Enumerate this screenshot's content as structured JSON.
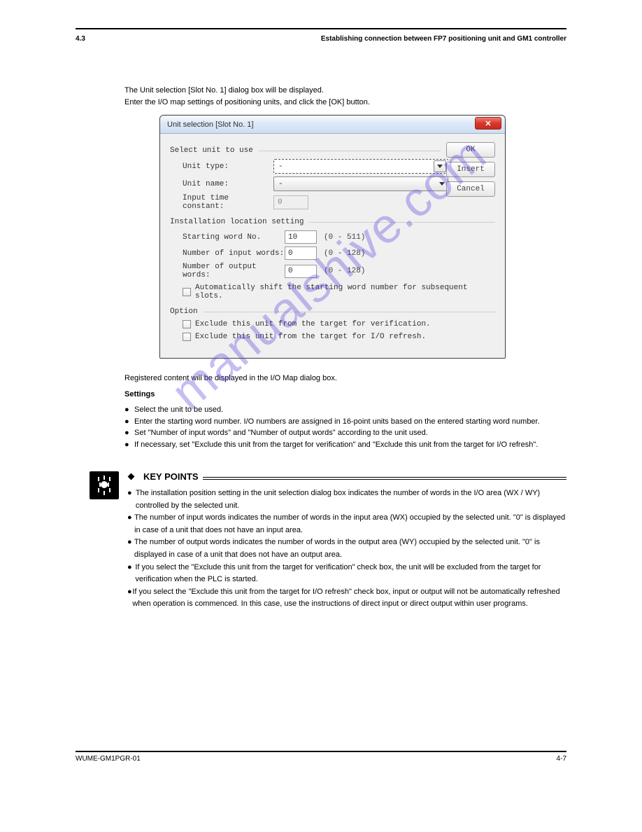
{
  "header": "Establishing connection between FP7 positioning unit and GM1 controller",
  "intro_line1": "The Unit selection [Slot No. 1] dialog box will be displayed.",
  "intro_line2": "Enter the I/O map settings of positioning units, and click the [OK] button.",
  "dialog": {
    "title": "Unit selection [Slot No. 1]",
    "section_select_unit": "Select unit to use",
    "unit_type_label": "Unit type:",
    "unit_type_value": "-",
    "unit_name_label": "Unit name:",
    "unit_name_value": "-",
    "input_time_label": "Input time constant:",
    "input_time_value": "0",
    "section_installation": "Installation location setting",
    "starting_word_label": "Starting word No.",
    "starting_word_value": "10",
    "starting_word_range": "(0 - 511)",
    "num_input_label": "Number of input words:",
    "num_input_value": "0",
    "num_input_range": "(0 - 128)",
    "num_output_label": "Number of output words:",
    "num_output_value": "0",
    "num_output_range": "(0 - 128)",
    "auto_shift": "Automatically shift the starting word number for subsequent slots.",
    "section_option": "Option",
    "exclude_verify": "Exclude this unit from the target for verification.",
    "exclude_refresh": "Exclude this unit from the target for I/O refresh.",
    "btn_ok": "OK",
    "btn_insert": "Insert",
    "btn_cancel": "Cancel"
  },
  "after": {
    "line1": "Registered content will be displayed in the I/O Map dialog box.",
    "settings_label": "Settings",
    "bullets": [
      "Select the unit to be used.",
      "Enter the starting word number. I/O numbers are assigned in 16-point units based on the entered starting word number.",
      "Set \"Number of input words\" and \"Number of output words\" according to the unit used.",
      "If necessary, set \"Exclude this unit from the target for verification\" and \"Exclude this unit from the target for I/O refresh\"."
    ]
  },
  "keypoint": {
    "title": "KEY POINTS",
    "paras": [
      "The installation position setting in the unit selection dialog box indicates the number of words in the I/O area (WX / WY) controlled by the selected unit.",
      "The number of input words indicates the number of words in the input area (WX) occupied by the selected unit. \"0\" is displayed in case of a unit that does not have an input area.",
      "The number of output words indicates the number of words in the output area (WY) occupied by the selected unit. \"0\" is displayed in case of a unit that does not have an output area.",
      "If you select the \"Exclude this unit from the target for verification\" check box, the unit will be excluded from the target for verification when the PLC is started.",
      "If you select the \"Exclude this unit from the target for I/O refresh\" check box, input or output will not be automatically refreshed when operation is commenced. In this case, use the instructions of direct input or direct output within user programs."
    ]
  },
  "footer_left": "WUME-GM1PGR-01",
  "footer_right": "4-7",
  "watermark": "manualshive.com"
}
